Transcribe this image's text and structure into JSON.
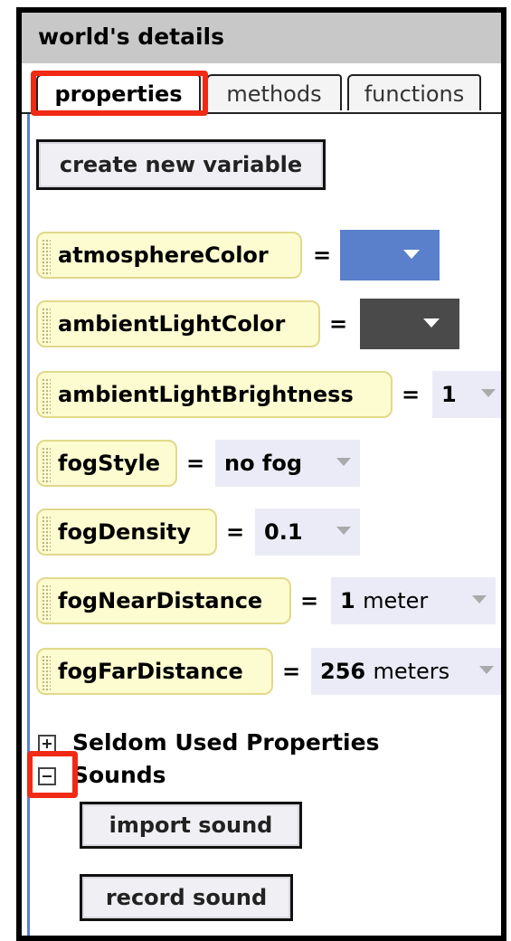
{
  "panel": {
    "title": "world's details",
    "tabs": [
      {
        "label": "properties",
        "active": true
      },
      {
        "label": "methods",
        "active": false
      },
      {
        "label": "functions",
        "active": false
      }
    ]
  },
  "create_variable_label": "create new variable",
  "properties": [
    {
      "name": "atmosphereColor",
      "eq": "=",
      "value_color": "#5a80cc"
    },
    {
      "name": "ambientLightColor",
      "eq": "=",
      "value_color": "#4a4a4a"
    },
    {
      "name": "ambientLightBrightness",
      "eq": "=",
      "value": "1"
    },
    {
      "name": "fogStyle",
      "eq": "=",
      "value": "no fog"
    },
    {
      "name": "fogDensity",
      "eq": "=",
      "value": "0.1"
    },
    {
      "name": "fogNearDistance",
      "eq": "=",
      "value": "1",
      "unit": "meter"
    },
    {
      "name": "fogFarDistance",
      "eq": "=",
      "value": "256",
      "unit": "meters"
    }
  ],
  "tree": {
    "seldom_label": "Seldom Used Properties",
    "sounds_label": "Sounds"
  },
  "sounds": {
    "import_label": "import sound",
    "record_label": "record sound"
  },
  "colors": {
    "highlight": "#f02a14",
    "panel_accent": "#5a7fd0"
  }
}
